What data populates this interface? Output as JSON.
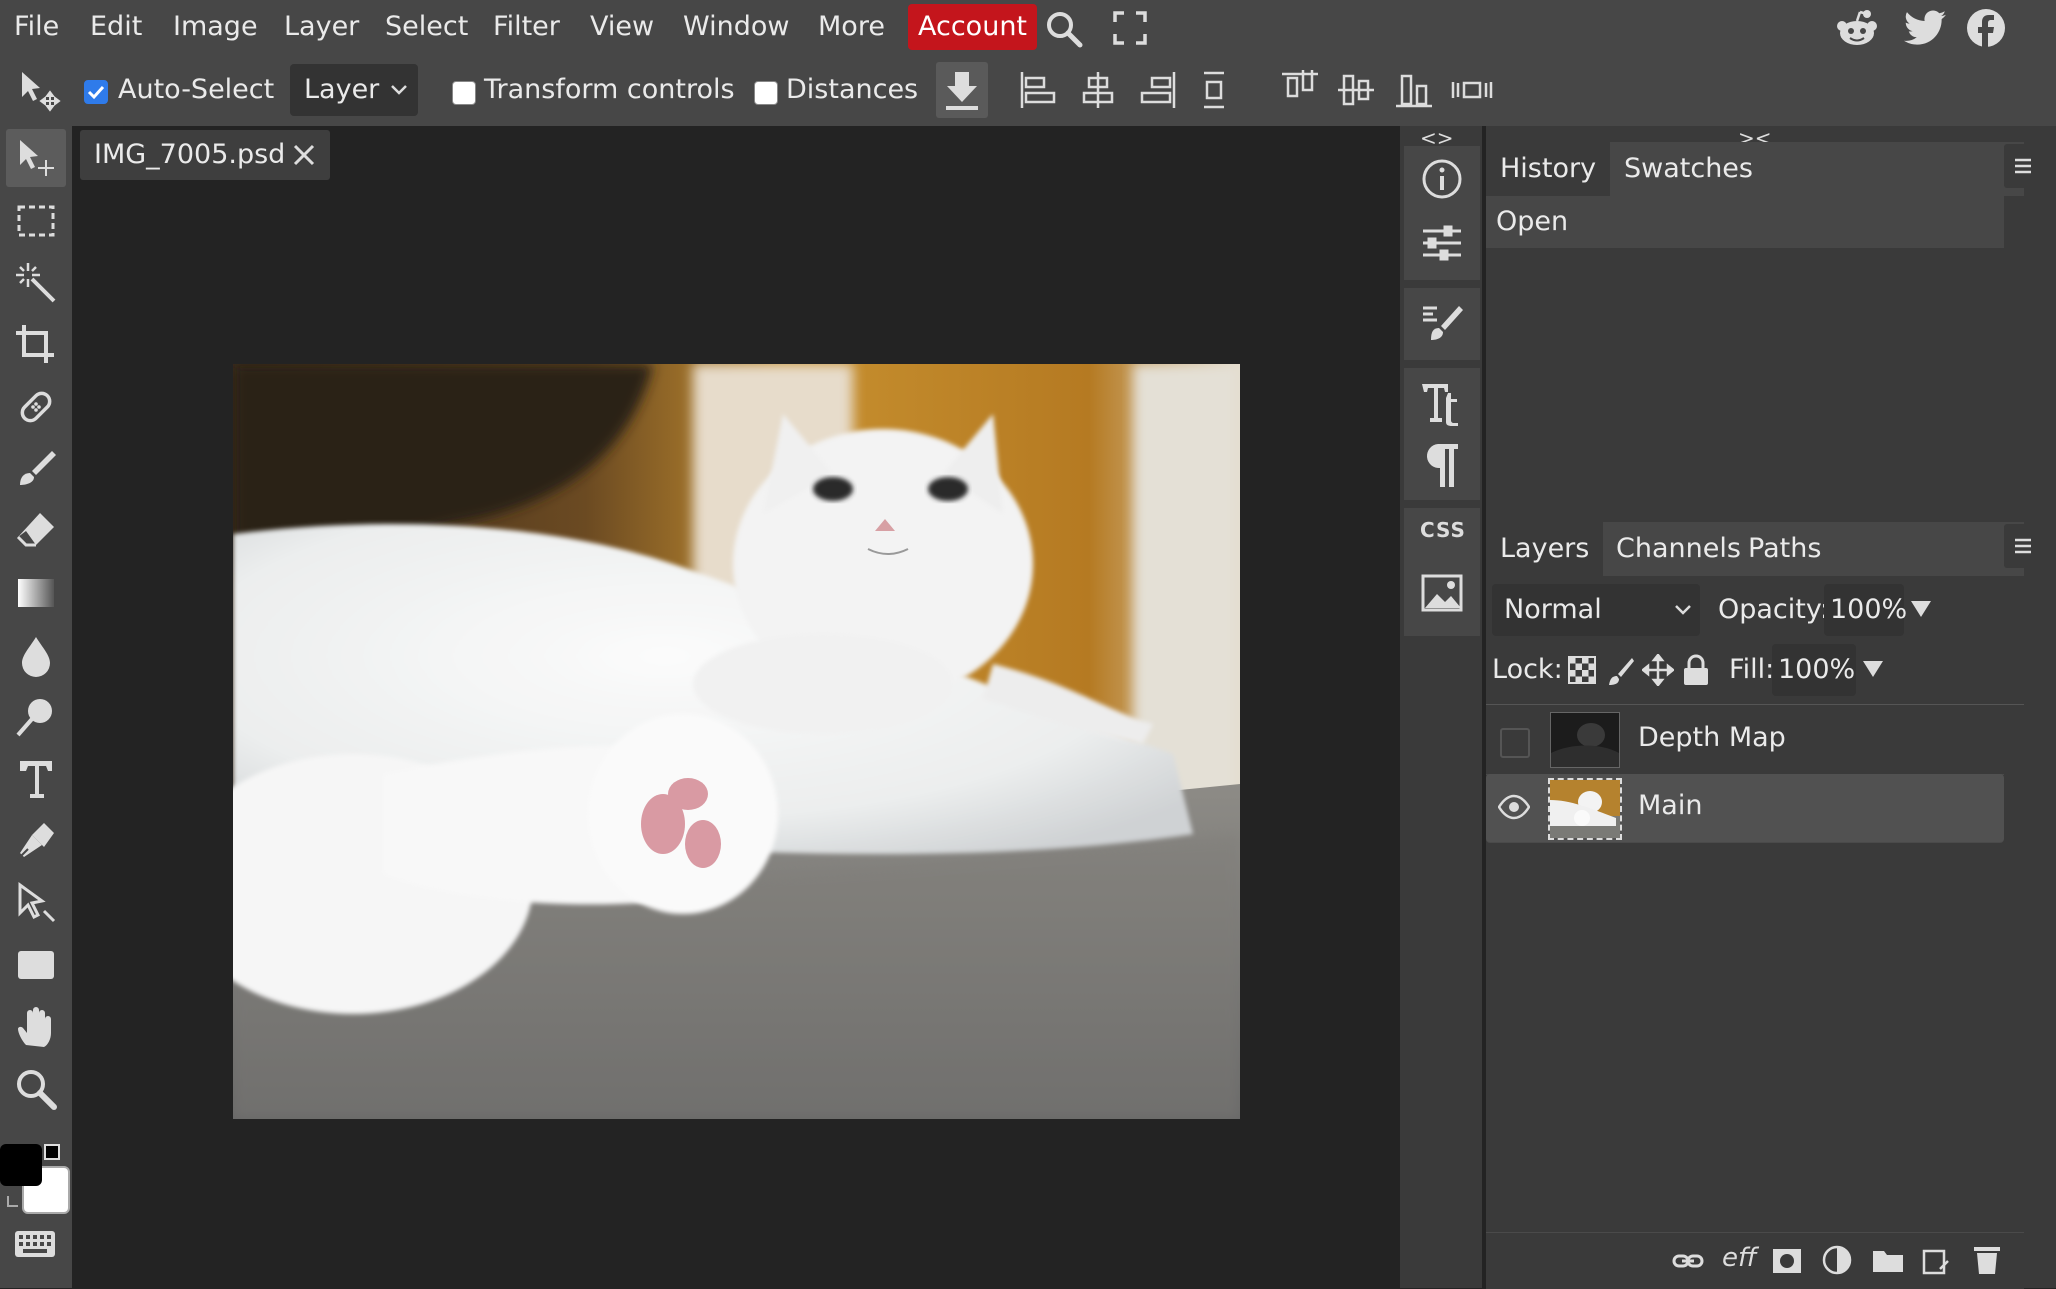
{
  "menu": {
    "items": [
      "File",
      "Edit",
      "Image",
      "Layer",
      "Select",
      "Filter",
      "View",
      "Window",
      "More"
    ],
    "account": "Account"
  },
  "options": {
    "auto_select": "Auto-Select",
    "auto_select_checked": true,
    "layer_select": "Layer",
    "transform_controls": "Transform controls",
    "distances": "Distances"
  },
  "document": {
    "tab_title": "IMG_7005.psd"
  },
  "colors": {
    "foreground": "#000000",
    "background": "#ffffff",
    "accent": "#c4151c",
    "checkbox": "#2f7bea"
  },
  "panel_top": {
    "tabs": [
      "History",
      "Swatches"
    ],
    "history_items": [
      "Open"
    ]
  },
  "panel_layers": {
    "tabs": [
      "Layers",
      "Channels",
      "Paths"
    ],
    "blend_mode": "Normal",
    "opacity_label": "Opacity:",
    "opacity_value": "100%",
    "lock_label": "Lock:",
    "fill_label": "Fill:",
    "fill_value": "100%",
    "layers": [
      {
        "name": "Depth Map",
        "visible": false
      },
      {
        "name": "Main",
        "visible": true
      }
    ]
  },
  "sidebar_icons": [
    "info-icon",
    "adjustments-icon",
    "brush-settings-icon",
    "character-icon",
    "paragraph-icon",
    "css-icon",
    "image-icon"
  ],
  "css_label": "CSS",
  "social": [
    "reddit-icon",
    "twitter-icon",
    "facebook-icon"
  ]
}
